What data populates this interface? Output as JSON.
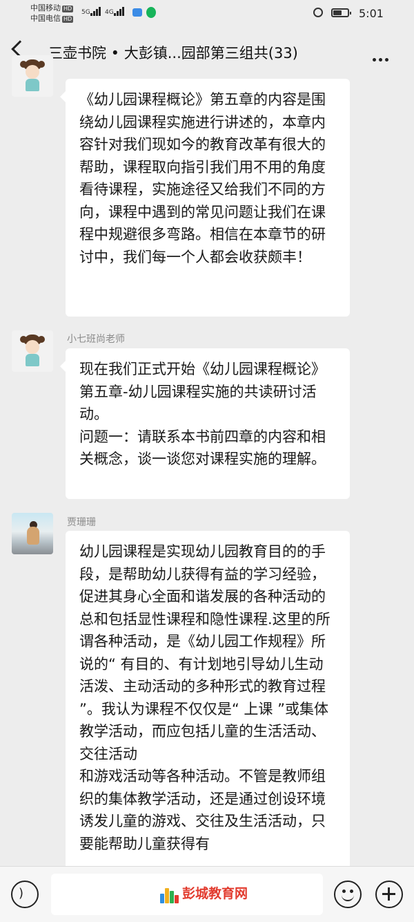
{
  "status_bar": {
    "carrier1": "中国移动",
    "carrier2": "中国电信",
    "hd_badge": "HD",
    "net1": "5G",
    "net2": "4G",
    "time": "5:01"
  },
  "header": {
    "title": "三壶书院 • 大彭镇...园部第三组共(33)"
  },
  "messages": [
    {
      "sender": "",
      "text": "《幼儿园课程概论》第五章的内容是围绕幼儿园课程实施进行讲述的，本章内容针对我们现如今的教育改革有很大的帮助，课程取向指引我们用不用的角度看待课程，实施途径又给我们不同的方向，课程中遇到的常见问题让我们在课程中规避很多弯路。相信在本章节的研讨中，我们每一个人都会收获颇丰！"
    },
    {
      "sender": "小七班尚老师",
      "text": "现在我们正式开始《幼儿园课程概论》第五章-幼儿园课程实施的共读研讨活动。\n问题一：请联系本书前四章的内容和相关概念，谈一谈您对课程实施的理解。"
    },
    {
      "sender": "贾珊珊",
      "text": "幼儿园课程是实现幼儿园教育目的的手段，是帮助幼儿获得有益的学习经验，促进其身心全面和谐发展的各种活动的总和包括显性课程和隐性课程.这里的所谓各种活动，是《幼儿园工作规程》所说的“ 有目的、有计划地引导幼儿生动活泼、主动活动的多种形式的教育过程 ”。我认为课程不仅仅是“ 上课 ”或集体教学活动，而应包括儿童的生活活动、交往活动\n和游戏活动等各种活动。不管是教师组织的集体教学活动，还是通过创设环境诱发儿童的游戏、交往及生活活动，只要能帮助儿童获得有"
    }
  ],
  "input_bar": {
    "watermark_text": "彭城教育网"
  },
  "colors": {
    "background": "#ededed",
    "bubble": "#ffffff",
    "watermark": "#e23b2e"
  },
  "icons": [
    "back-arrow-icon",
    "more-icon",
    "voice-icon",
    "emoji-icon",
    "plus-icon"
  ]
}
